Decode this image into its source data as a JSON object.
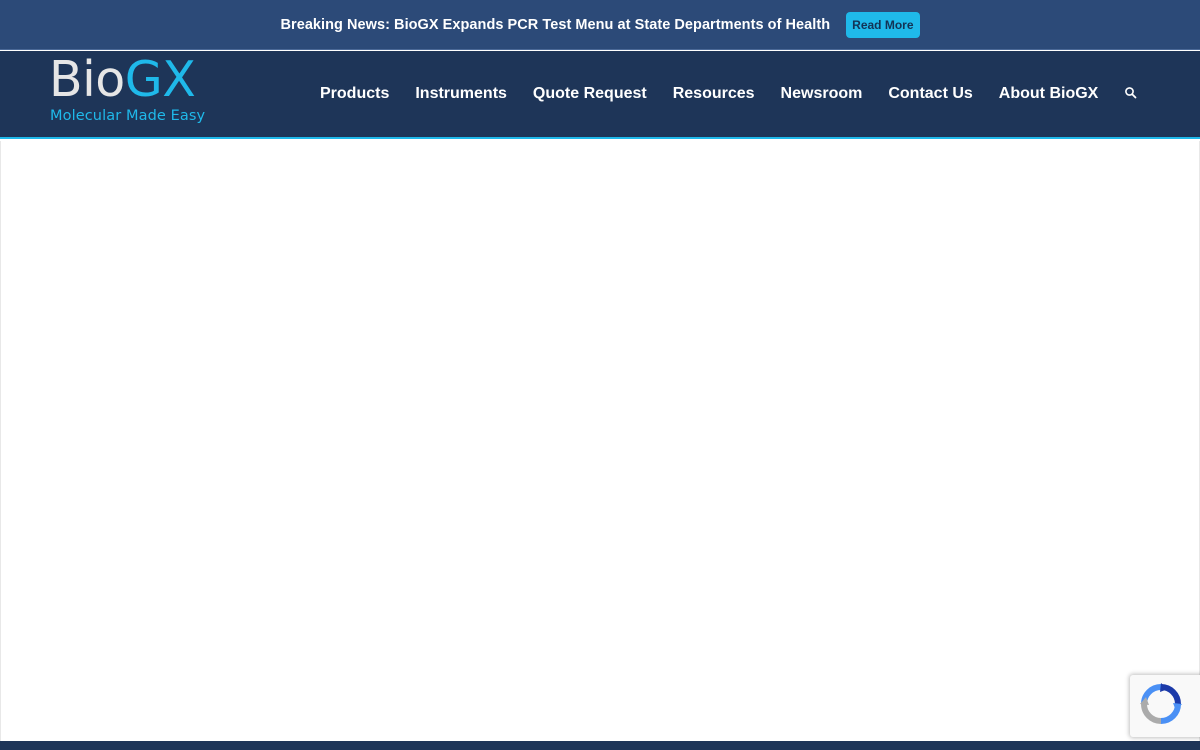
{
  "news_bar": {
    "text": "Breaking News: BioGX Expands PCR Test Menu at State Departments of Health",
    "button_label": "Read More"
  },
  "logo": {
    "bio": "Bio",
    "gx": "GX",
    "tagline": "Molecular Made Easy"
  },
  "nav": {
    "items": [
      {
        "label": "Products"
      },
      {
        "label": "Instruments"
      },
      {
        "label": "Quote Request"
      },
      {
        "label": "Resources"
      },
      {
        "label": "Newsroom"
      },
      {
        "label": "Contact Us"
      },
      {
        "label": "About BioGX"
      }
    ],
    "search_icon": "search-icon"
  },
  "colors": {
    "news_bar_bg": "#2c4a78",
    "header_bg": "#1e3558",
    "accent": "#1fb9ea",
    "button_text": "#133355"
  },
  "widgets": {
    "recaptcha_icon": "recaptcha-icon"
  }
}
